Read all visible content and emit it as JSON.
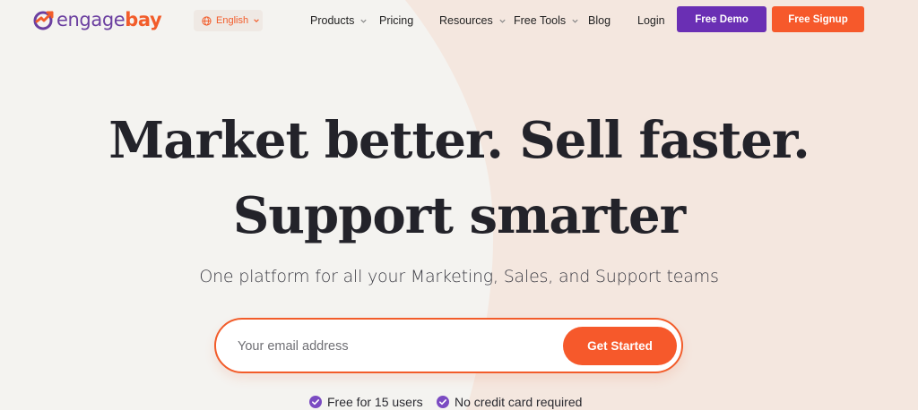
{
  "brand": {
    "name_part1": "engage",
    "name_part2": "bay",
    "logo_icon": "engagebay-logo-icon",
    "primary_purple": "#6a2fb4",
    "primary_orange": "#f6592b"
  },
  "nav": {
    "language": {
      "label": "English",
      "icon": "globe-icon"
    },
    "items": [
      {
        "label": "Products",
        "has_dropdown": true
      },
      {
        "label": "Pricing",
        "has_dropdown": false
      },
      {
        "label": "Resources",
        "has_dropdown": true
      },
      {
        "label": "Free Tools",
        "has_dropdown": true
      },
      {
        "label": "Blog",
        "has_dropdown": false
      },
      {
        "label": "Login",
        "has_dropdown": false
      }
    ],
    "demo_button": "Free Demo",
    "signup_button": "Free Signup"
  },
  "hero": {
    "title_line1": "Market better. Sell faster.",
    "title_line2": "Support smarter",
    "subtitle": "One platform for all your Marketing, Sales, and Support teams",
    "email_placeholder": "Your email address",
    "cta_button": "Get Started",
    "perks": [
      {
        "label": "Free for 15 users",
        "icon": "check-circle-icon"
      },
      {
        "label": "No credit card required",
        "icon": "check-circle-icon"
      }
    ]
  }
}
